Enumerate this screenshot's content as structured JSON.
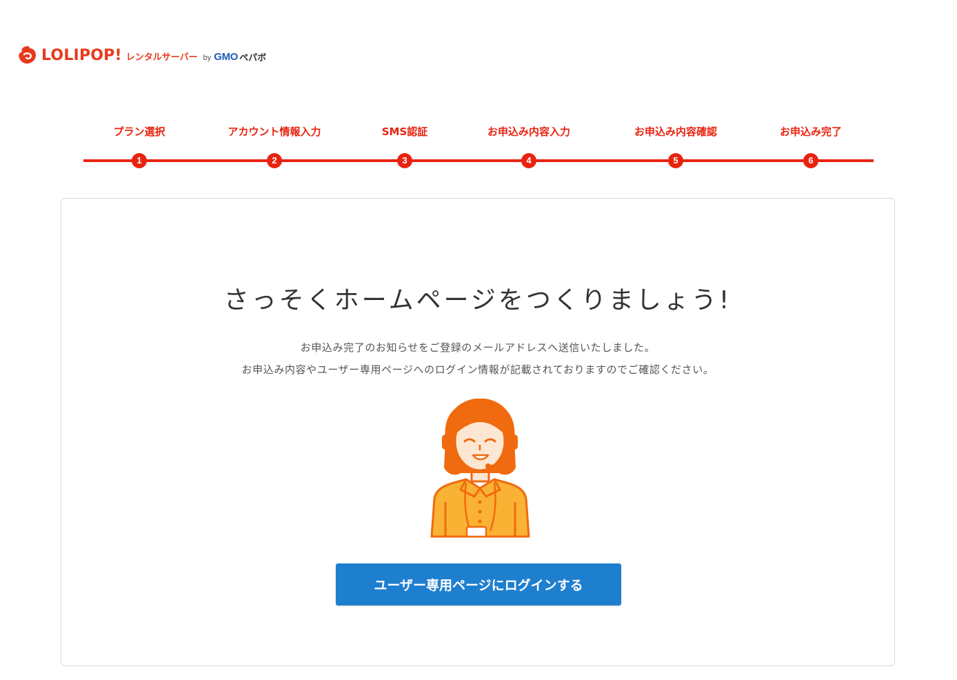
{
  "header": {
    "brand_name": "LOLIPOP!",
    "brand_sub": "レンタルサーバー",
    "by": "by",
    "company": "GMO",
    "company_sub": "ペパボ"
  },
  "steps": [
    {
      "label": "プラン選択",
      "num": "1"
    },
    {
      "label": "アカウント情報入力",
      "num": "2"
    },
    {
      "label": "SMS認証",
      "num": "3"
    },
    {
      "label": "お申込み内容入力",
      "num": "4"
    },
    {
      "label": "お申込み内容確認",
      "num": "5"
    },
    {
      "label": "お申込み完了",
      "num": "6"
    }
  ],
  "main": {
    "headline": "さっそくホームページをつくりましょう!",
    "message_line1": "お申込み完了のお知らせをご登録のメールアドレスへ送信いたしました。",
    "message_line2": "お申込み内容やユーザー専用ページへのログイン情報が記載されておりますのでご確認ください。",
    "login_button": "ユーザー専用ページにログインする"
  },
  "colors": {
    "brand_red": "#e8230f",
    "button_blue": "#1f7fcf",
    "illustration_orange": "#f06a0f",
    "illustration_yellow": "#f9b233"
  }
}
